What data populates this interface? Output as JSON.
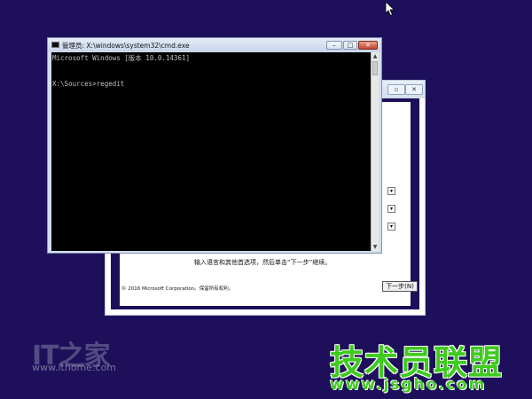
{
  "cmd": {
    "title": "管理员: X:\\windows\\system32\\cmd.exe",
    "lines": [
      "Microsoft Windows [版本 10.0.14361]",
      "",
      "X:\\Sources>regedit"
    ],
    "minimize_glyph": "–",
    "maximize_glyph": "□",
    "close_glyph": "✕"
  },
  "setup": {
    "instruction": "输入语言和其他首选项，然后单击“下一步”继续。",
    "copyright": "© 2016 Microsoft Corporation。保留所有权利。",
    "next_button": "下一步(N)",
    "restore_glyph": "▫",
    "close_glyph": "✕"
  },
  "watermarks": {
    "left_logo": "IT之家",
    "left_url": "www.ithome.com",
    "right_text": "技术员联盟",
    "right_url": "www.jsgho.com"
  },
  "colors": {
    "desktop": "#1d0f5a",
    "console_bg": "#000000",
    "console_text": "#c0c0c0",
    "watermark_green": "#3ecb1e"
  }
}
